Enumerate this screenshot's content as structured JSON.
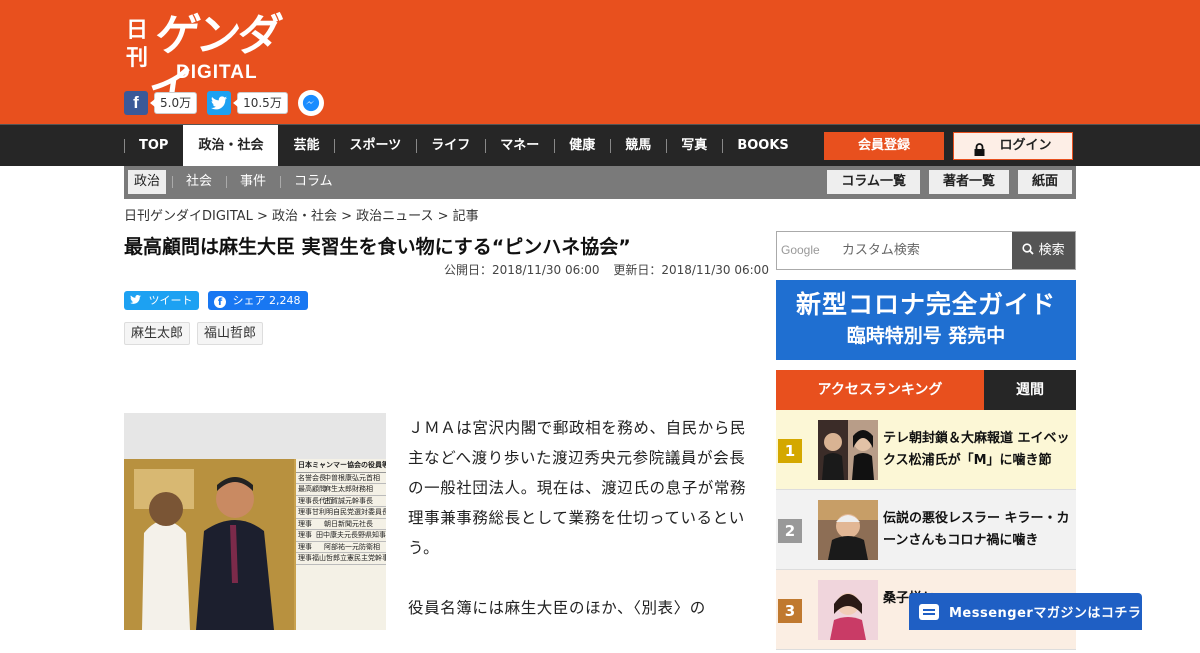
{
  "logo": {
    "line1": "日刊",
    "line2": "ゲンダイ",
    "line3": "DIGITAL"
  },
  "social": {
    "facebook_count": "5.0万",
    "twitter_count": "10.5万"
  },
  "nav": {
    "items": [
      "TOP",
      "政治・社会",
      "芸能",
      "スポーツ",
      "ライフ",
      "マネー",
      "健康",
      "競馬",
      "写真",
      "BOOKS"
    ],
    "active": "政治・社会",
    "register": "会員登録",
    "login": "ログイン"
  },
  "subnav": {
    "items": [
      "政治",
      "社会",
      "事件",
      "コラム"
    ],
    "active": "政治",
    "right": [
      "コラム一覧",
      "著者一覧",
      "紙面"
    ]
  },
  "breadcrumb": "日刊ゲンダイDIGITAL > 政治・社会 > 政治ニュース > 記事",
  "article": {
    "title": "最高顧問は麻生大臣 実習生を食い物にする“ピンハネ協会”",
    "published": "公開日：2018/11/30 06:00",
    "updated": "更新日：2018/11/30 06:00",
    "tweet_label": "ツイート",
    "share_label": "シェア 2,248",
    "tags": [
      "麻生太郎",
      "福山哲郎"
    ],
    "paragraphs": [
      "ＪＭＡは宮沢内閣で郵政相を務め、自民から民主などへ渡り歩いた渡辺秀央元参院議員が会長の一般社団法人。現在は、渡辺氏の息子が常務理事兼事務総長として業務を仕切っているという。",
      "役員名簿には麻生大臣のほか、〈別表〉の"
    ],
    "photo_table": {
      "heading": "日本ミャンマー協会の役員等",
      "rows": [
        [
          "名誉会長",
          "中曽根康弘元首相"
        ],
        [
          "最高顧問",
          "麻生太郎財務相"
        ],
        [
          "理事長代行",
          "古賀誠元幹事長"
        ],
        [
          "理事",
          "甘利明自民党選対委員長"
        ],
        [
          "理事",
          "朝日新聞元社長"
        ],
        [
          "理事",
          "田中康夫元長野県知事"
        ],
        [
          "理事",
          "阿部祐一元防衛相"
        ],
        [
          "理事",
          "福山哲郎立憲民主党幹事長"
        ]
      ]
    }
  },
  "sidebar": {
    "search": {
      "brand": "Google",
      "placeholder": "カスタム検索",
      "button": "検索"
    },
    "banner": {
      "line1": "新型コロナ完全ガイド",
      "line2": "臨時特別号 発売中"
    },
    "ranking": {
      "title": "アクセスランキング",
      "period": "週間",
      "items": [
        {
          "rank": "1",
          "text": "テレ朝封鎖＆大麻報道 エイベックス松浦氏が「M」に噛き節"
        },
        {
          "rank": "2",
          "text": "伝説の悪役レスラー キラー・カーンさんもコロナ禍に噛き"
        },
        {
          "rank": "3",
          "text": "桑子悦と"
        }
      ]
    }
  },
  "messenger": "Messengerマガジンはコチラ",
  "colors": {
    "brand": "#e8501e",
    "nav_bg": "#262626",
    "subnav_bg": "#7a7a7a",
    "banner": "#1f6fd1"
  }
}
